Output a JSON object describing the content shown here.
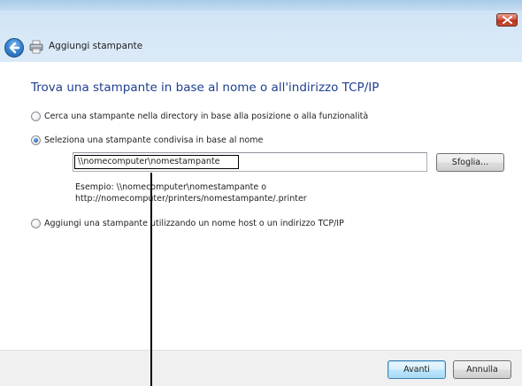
{
  "window": {
    "title": "Aggiungi stampante"
  },
  "page": {
    "heading": "Trova una stampante in base al nome o all'indirizzo TCP/IP"
  },
  "options": [
    {
      "label": "Cerca una stampante nella directory in base alla posizione o alla funzionalità",
      "selected": false
    },
    {
      "label": "Seleziona una stampante condivisa in base al nome",
      "selected": true
    },
    {
      "label": "Aggiungi una stampante utilizzando un nome host o un indirizzo TCP/IP",
      "selected": false
    }
  ],
  "shared_printer": {
    "input_value": "\\\\nomecomputer\\nomestampante",
    "browse_label": "Sfoglia...",
    "example_line1": "Esempio: \\\\nomecomputer\\nomestampante o",
    "example_line2": "http://nomecomputer/printers/nomestampante/.printer"
  },
  "footer": {
    "next_label": "Avanti",
    "cancel_label": "Annulla"
  },
  "icons": {
    "close": "close-icon",
    "back": "back-arrow-icon",
    "printer": "printer-icon"
  },
  "colors": {
    "heading": "#1e3f8f",
    "title_bar": "#cfe4f6",
    "close_button": "#c74c33",
    "footer": "#f0f0f0"
  }
}
